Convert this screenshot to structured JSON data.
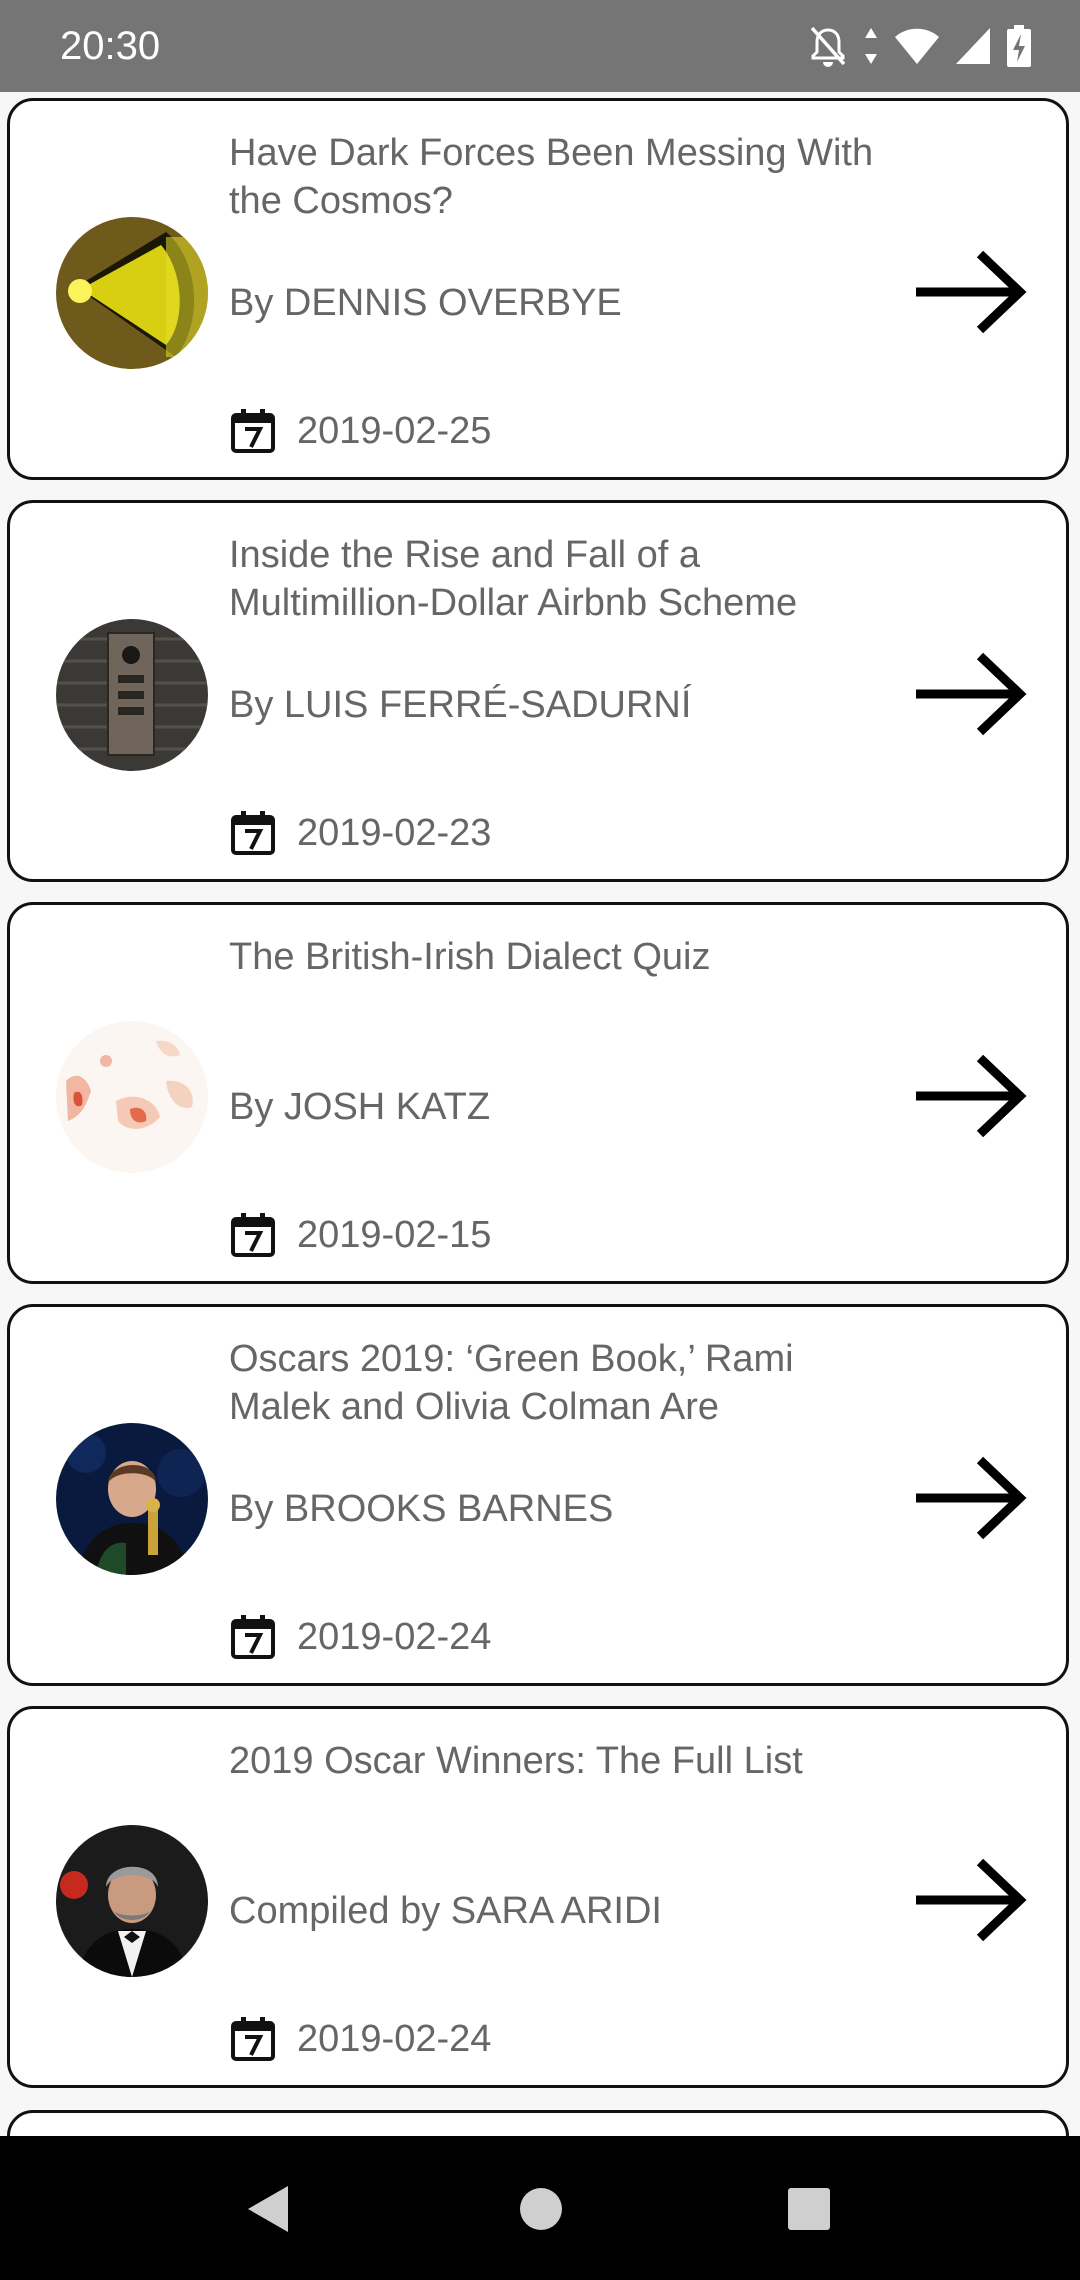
{
  "status_bar": {
    "time": "20:30"
  },
  "articles": [
    {
      "title": "Have Dark Forces Been Messing With the Cosmos?",
      "byline": "By DENNIS OVERBYE",
      "date": "2019-02-25",
      "thumbnail": "cosmos-yellow"
    },
    {
      "title": "Inside the Rise and Fall of a Multimillion-Dollar Airbnb Scheme",
      "byline": "By LUIS FERRÉ-SADURNÍ",
      "date": "2019-02-23",
      "thumbnail": "door-intercom"
    },
    {
      "title": "The British-Irish Dialect Quiz",
      "byline": "By JOSH KATZ",
      "date": "2019-02-15",
      "thumbnail": "dialect-map"
    },
    {
      "title": "Oscars 2019: ‘Green Book,’ Rami Malek and Olivia Colman Are",
      "byline": "By BROOKS BARNES",
      "date": "2019-02-24",
      "thumbnail": "oscar-olivia"
    },
    {
      "title": "2019 Oscar Winners: The Full List",
      "byline": "Compiled by SARA ARIDI",
      "date": "2019-02-24",
      "thumbnail": "oscar-tuxedo"
    }
  ],
  "icons": {
    "calendar": "calendar-icon",
    "open_article": "arrow-right-icon"
  },
  "colors": {
    "status_bar": "#757575",
    "card_border": "#111111",
    "text_secondary": "#666666",
    "nav_bar": "#000000",
    "background": "#f7f7f7"
  }
}
